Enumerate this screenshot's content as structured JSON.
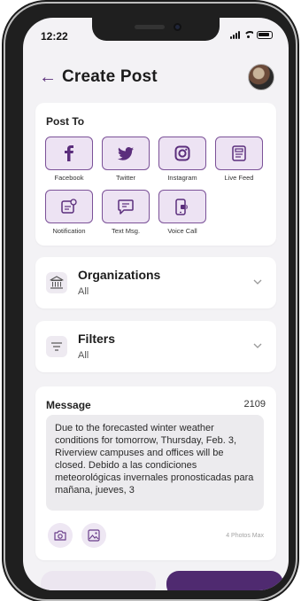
{
  "status": {
    "time": "12:22"
  },
  "header": {
    "title": "Create Post"
  },
  "post_to": {
    "title": "Post To",
    "channels": [
      {
        "label": "Facebook",
        "icon": "facebook-icon"
      },
      {
        "label": "Twitter",
        "icon": "twitter-icon"
      },
      {
        "label": "Instagram",
        "icon": "instagram-icon"
      },
      {
        "label": "Live Feed",
        "icon": "live-feed-icon"
      },
      {
        "label": "Notification",
        "icon": "notification-icon"
      },
      {
        "label": "Text Msg.",
        "icon": "text-message-icon"
      },
      {
        "label": "Voice Call",
        "icon": "voice-call-icon"
      }
    ]
  },
  "organizations": {
    "title": "Organizations",
    "value": "All",
    "icon": "building-icon"
  },
  "filters": {
    "title": "Filters",
    "value": "All",
    "icon": "filter-icon"
  },
  "message": {
    "title": "Message",
    "count": "2109",
    "text": "Due to the forecasted winter weather conditions for tomorrow, Thursday, Feb. 3, Riverview campuses and offices will be closed. Debido a las condiciones meteorológicas invernales pronosticadas para mañana, jueves, 3",
    "photos_max": "4 Photos Max"
  },
  "colors": {
    "accent": "#5b2e7c",
    "tile_bg": "#ede3f3",
    "background": "#f3f2f5"
  }
}
